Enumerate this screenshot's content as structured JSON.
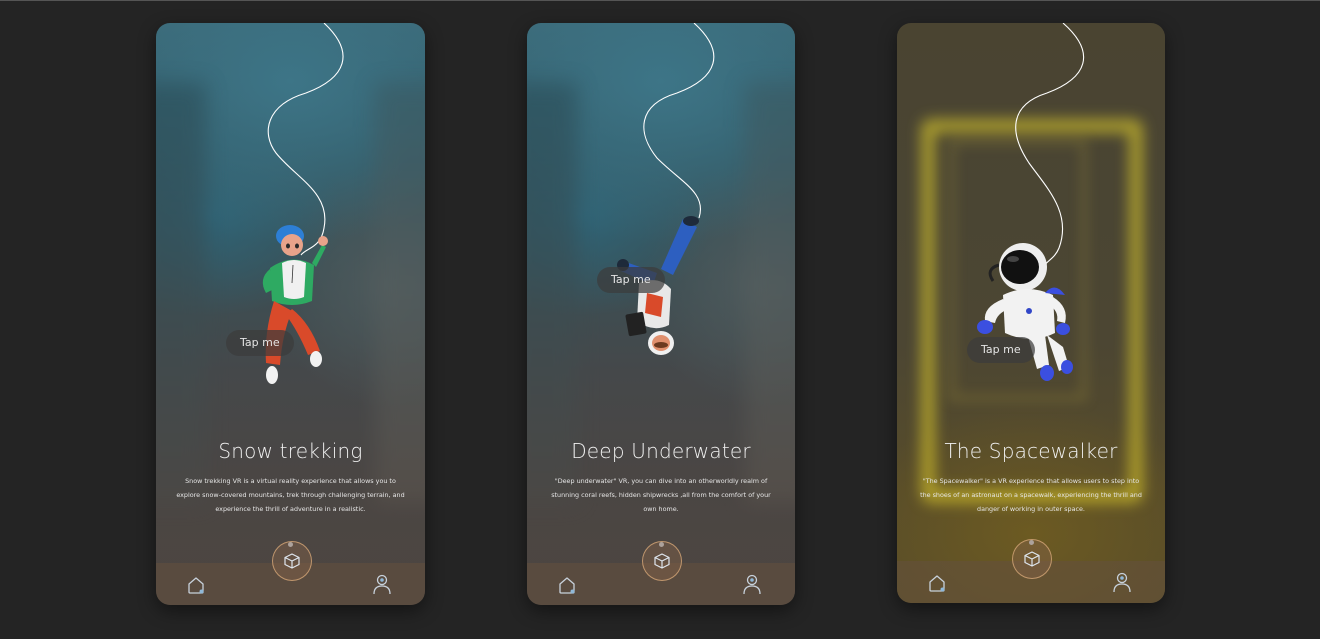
{
  "screens": [
    {
      "title": "Snow trekking",
      "description": "Snow trekking VR is a virtual reality experience that allows you to explore snow-covered mountains, trek through challenging terrain, and experience the thrill of adventure in a realistic.",
      "tap_label": "Tap me"
    },
    {
      "title": "Deep Underwater",
      "description": "\"Deep underwater\" VR, you can dive into an otherworldly realm of stunning coral reefs, hidden shipwrecks ,all from the comfort of your own home.",
      "tap_label": "Tap me"
    },
    {
      "title": "The Spacewalker",
      "description": "\"The Spacewalker\" is a VR experience that allows users to step into the shoes of an astronaut on a spacewalk, experiencing the thrill and danger of working in outer space.",
      "tap_label": "Tap me"
    }
  ],
  "icons": {
    "home": "home-icon",
    "center": "vr-cube-icon",
    "profile": "profile-icon"
  },
  "colors": {
    "page_background": "#242424",
    "ocean_top": "#3b6876",
    "space_neon": "#e7d62c",
    "navbar": "#64503e",
    "center_ring": "#d6a878"
  }
}
